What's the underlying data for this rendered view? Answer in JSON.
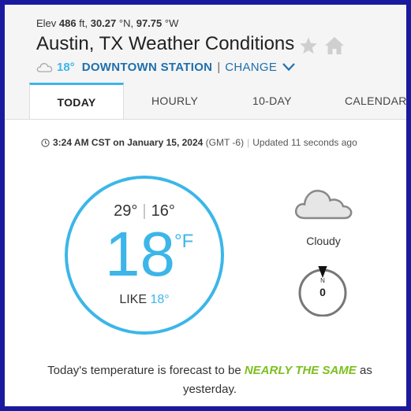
{
  "header": {
    "elev_label": "Elev",
    "elev_value": "486",
    "elev_unit": "ft,",
    "lat_value": "30.27",
    "lat_unit": "°N,",
    "lon_value": "97.75",
    "lon_unit": "°W",
    "title": "Austin, TX Weather Conditions",
    "favorite_icon": "star-icon",
    "home_icon": "home-icon"
  },
  "station": {
    "icon": "cloud-icon",
    "temp": "18°",
    "name": "DOWNTOWN STATION",
    "separator": "|",
    "change_label": "CHANGE"
  },
  "tabs": [
    {
      "label": "TODAY",
      "active": true
    },
    {
      "label": "HOURLY",
      "active": false
    },
    {
      "label": "10-DAY",
      "active": false
    },
    {
      "label": "CALENDAR",
      "active": false
    }
  ],
  "timestamp": {
    "time": "3:24 AM CST on January 15, 2024",
    "tz": "(GMT -6)",
    "updated": "Updated 11 seconds ago"
  },
  "current": {
    "high": "29°",
    "low": "16°",
    "temp": "18",
    "unit": "°F",
    "feels_like_label": "LIKE",
    "feels_like": "18°"
  },
  "condition": {
    "icon": "cloud-icon",
    "text": "Cloudy"
  },
  "wind": {
    "direction": "N",
    "speed": "0"
  },
  "forecast": {
    "prefix": "Today's temperature is forecast to be",
    "highlight": "NEARLY THE SAME",
    "suffix": "as yesterday."
  },
  "colors": {
    "accent": "#3cb6e8",
    "link": "#1f6fad",
    "highlight": "#7cbf1f",
    "frame": "#1a1a9e"
  }
}
